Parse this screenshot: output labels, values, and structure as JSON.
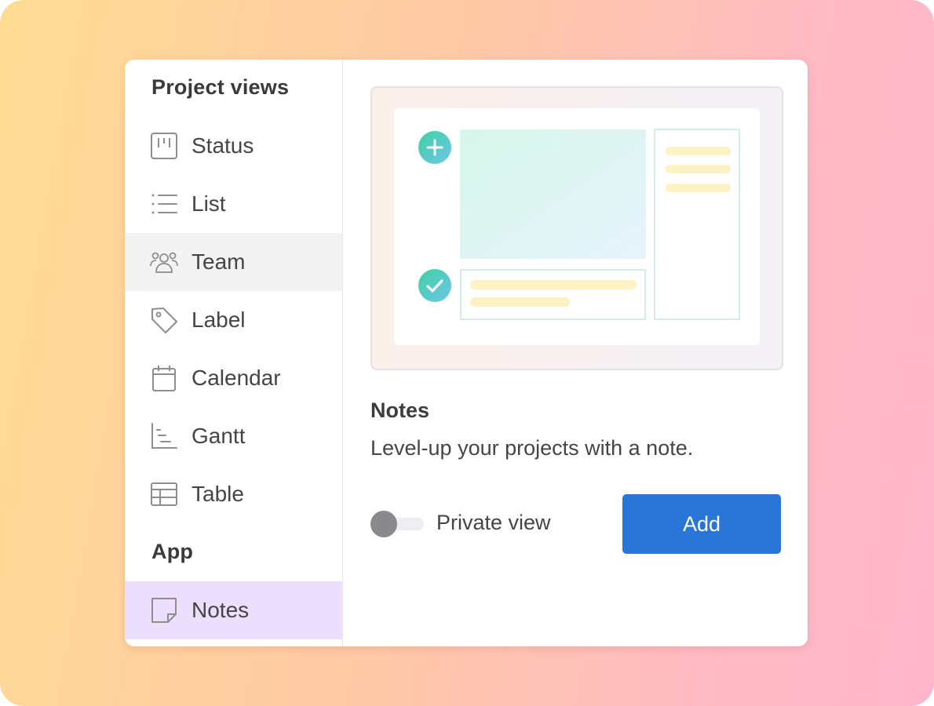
{
  "sidebar": {
    "project_views_heading": "Project views",
    "app_heading": "App",
    "items": [
      {
        "label": "Status",
        "icon": "status-board-icon"
      },
      {
        "label": "List",
        "icon": "list-icon"
      },
      {
        "label": "Team",
        "icon": "team-icon",
        "state": "hover"
      },
      {
        "label": "Label",
        "icon": "tag-icon"
      },
      {
        "label": "Calendar",
        "icon": "calendar-icon"
      },
      {
        "label": "Gantt",
        "icon": "gantt-icon"
      },
      {
        "label": "Table",
        "icon": "table-icon"
      }
    ],
    "app_items": [
      {
        "label": "Notes",
        "icon": "note-icon",
        "state": "selected"
      }
    ]
  },
  "detail": {
    "title": "Notes",
    "description": "Level-up your projects with a note.",
    "private_view_label": "Private view",
    "private_view_enabled": false,
    "add_label": "Add"
  },
  "colors": {
    "accent": "#2a75d8",
    "selected_bg": "#ecdffd",
    "hover_bg": "#f3f3f3",
    "icon_gray": "#8e8e8e",
    "illustration_teal": "#4fcfb0",
    "illustration_yellow": "#fdf2c4"
  }
}
